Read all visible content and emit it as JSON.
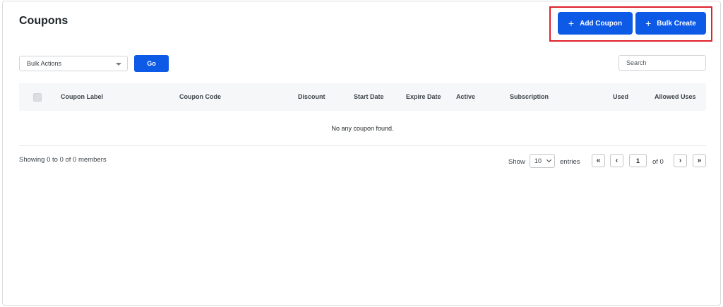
{
  "header": {
    "title": "Coupons",
    "add_coupon_label": "Add Coupon",
    "bulk_create_label": "Bulk Create",
    "plus_glyph": "+"
  },
  "toolbar": {
    "bulk_actions_selected": "Bulk Actions",
    "go_label": "Go",
    "search_placeholder": "Search"
  },
  "table": {
    "columns": {
      "coupon_label": "Coupon Label",
      "coupon_code": "Coupon Code",
      "discount": "Discount",
      "start_date": "Start Date",
      "expire_date": "Expire Date",
      "active": "Active",
      "subscription": "Subscription",
      "used": "Used",
      "allowed_uses": "Allowed Uses"
    },
    "empty_message": "No any coupon found."
  },
  "footer": {
    "showing_text": "Showing 0 to 0 of 0 members",
    "show_label": "Show",
    "entries_value": "10",
    "entries_label": "entries",
    "first_glyph": "«",
    "prev_glyph": "‹",
    "page_value": "1",
    "of_text": "of 0",
    "next_glyph": "›",
    "last_glyph": "»"
  },
  "colors": {
    "primary": "#0d5ae6",
    "highlight": "#e0202b",
    "table_header_bg": "#f6f7f9"
  }
}
